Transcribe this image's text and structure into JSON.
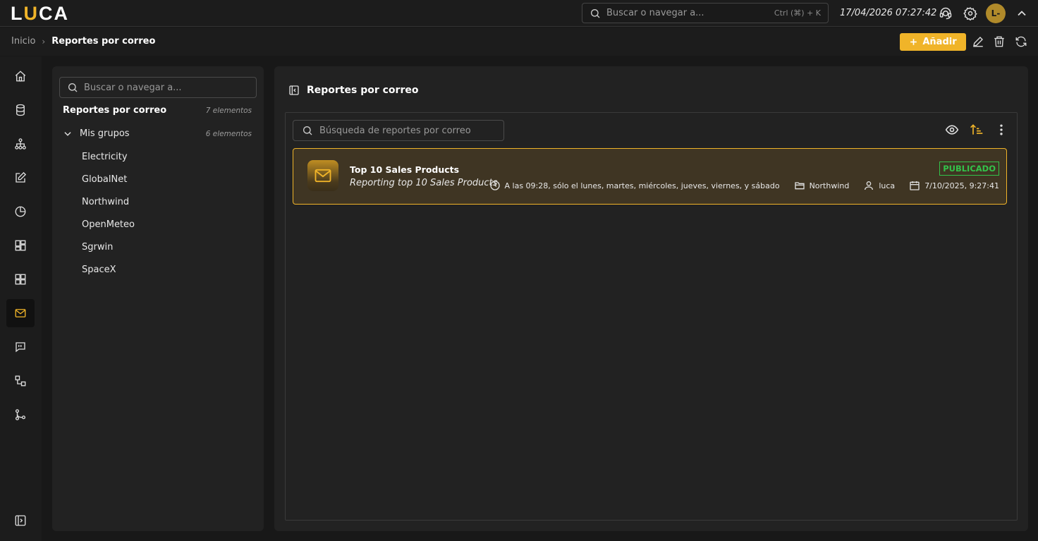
{
  "app": {
    "logo_left": "L",
    "logo_accent": "U",
    "logo_right": "CA",
    "accent_color": "#f0b429"
  },
  "topbar": {
    "search_placeholder": "Buscar o navegar a...",
    "shortcut": "Ctrl (⌘) + K",
    "datetime": "17/04/2026 07:27:42",
    "avatar_initials": "L-",
    "icons": [
      "support-agent-icon",
      "gear-icon",
      "chevron-up-icon"
    ]
  },
  "breadcrumb": {
    "home": "Inicio",
    "separator": "›",
    "current": "Reportes por correo"
  },
  "toolbar": {
    "add_label": "Añadir",
    "icons": [
      "pencil-icon",
      "trash-icon",
      "refresh-icon"
    ]
  },
  "rail": {
    "items": [
      "home-icon",
      "database-icon",
      "hierarchy-icon",
      "edit-icon",
      "pie-chart-icon",
      "dashboard-icon",
      "grid-icon",
      "mail-icon",
      "chat-icon",
      "workflow-icon",
      "branch-icon"
    ],
    "active": "mail-icon",
    "bottom": "sidebar-expand-icon"
  },
  "tree": {
    "search_placeholder": "Buscar o navegar a...",
    "title": "Reportes por correo",
    "count": "7 elementos",
    "group": {
      "label": "Mis grupos",
      "count": "6 elementos"
    },
    "items": [
      "Electricity",
      "GlobalNet",
      "Northwind",
      "OpenMeteo",
      "Sgrwin",
      "SpaceX"
    ]
  },
  "main": {
    "title": "Reportes por correo",
    "search_placeholder": "Búsqueda de reportes por correo",
    "report": {
      "title": "Top 10 Sales Products",
      "subtitle": "Reporting top 10 Sales Products",
      "status": "PUBLICADO",
      "status_color": "#33c24a",
      "schedule": "A las 09:28, sólo el lunes, martes, miércoles, jueves, viernes, y sábado",
      "folder": "Northwind",
      "user": "luca",
      "date": "7/10/2025, 9:27:41"
    }
  }
}
